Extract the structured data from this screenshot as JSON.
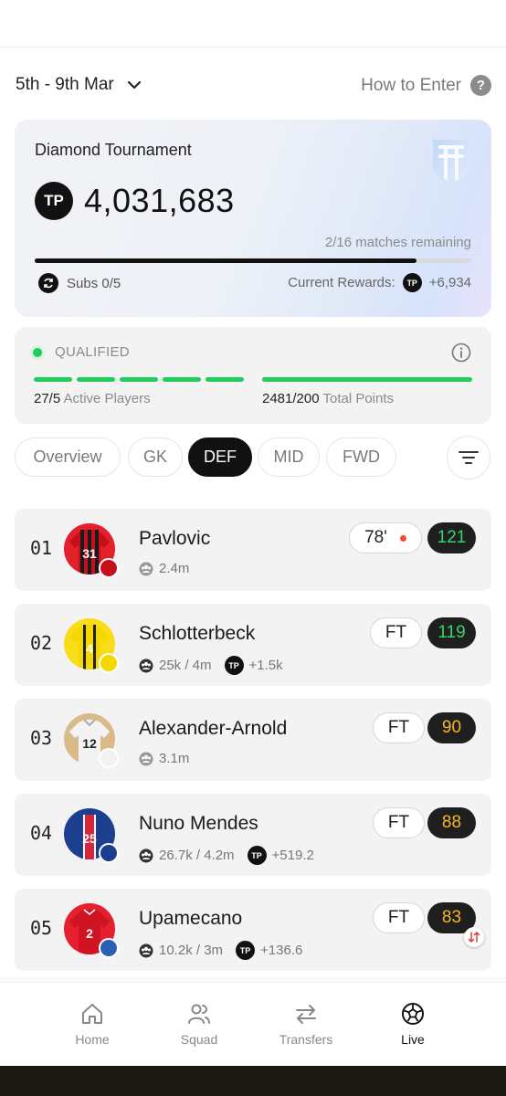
{
  "period": {
    "label": "5th - 9th Mar",
    "how_to_enter": "How to Enter",
    "help_glyph": "?"
  },
  "tournament": {
    "title": "Diamond Tournament",
    "points": "4,031,683",
    "tp_label": "TP",
    "matches_remaining": "2/16 matches remaining",
    "match_progress": 0.875,
    "subs": "Subs 0/5",
    "rewards_label": "Current Rewards:",
    "rewards_value": "+6,934"
  },
  "qualification": {
    "status": "QUALIFIED",
    "active_value": "27/5",
    "active_label": "Active Players",
    "points_value": "2481/200",
    "points_label": "Total Points"
  },
  "tabs": [
    "Overview",
    "GK",
    "DEF",
    "MID",
    "FWD"
  ],
  "active_tab": "DEF",
  "players": [
    {
      "rank": "01",
      "name": "Pavlovic",
      "owners": "2.4m",
      "status": "78'",
      "live": true,
      "score": "121",
      "score_color": "#2fd66a",
      "shirt": "31"
    },
    {
      "rank": "02",
      "name": "Schlotterbeck",
      "owners": "25k / 4m",
      "tp": "+1.5k",
      "status": "FT",
      "score": "119",
      "score_color": "#2fd66a",
      "shirt": "4"
    },
    {
      "rank": "03",
      "name": "Alexander-Arnold",
      "owners": "3.1m",
      "status": "FT",
      "score": "90",
      "score_color": "#f5b623",
      "shirt": "12"
    },
    {
      "rank": "04",
      "name": "Nuno Mendes",
      "owners": "26.7k / 4.2m",
      "tp": "+519.2",
      "status": "FT",
      "score": "88",
      "score_color": "#f5b623",
      "shirt": "25"
    },
    {
      "rank": "05",
      "name": "Upamecano",
      "owners": "10.2k / 3m",
      "tp": "+136.6",
      "status": "FT",
      "score": "83",
      "score_color": "#f5b623",
      "shirt": "2"
    }
  ],
  "nav": [
    {
      "label": "Home",
      "icon": "home-icon"
    },
    {
      "label": "Squad",
      "icon": "users-icon"
    },
    {
      "label": "Transfers",
      "icon": "swap-arrows-icon"
    },
    {
      "label": "Live",
      "icon": "football-icon"
    }
  ],
  "colors": {
    "qualified_green": "#1fcc5c",
    "live_dot": "#f04f2a",
    "active_tab": "#111111"
  }
}
